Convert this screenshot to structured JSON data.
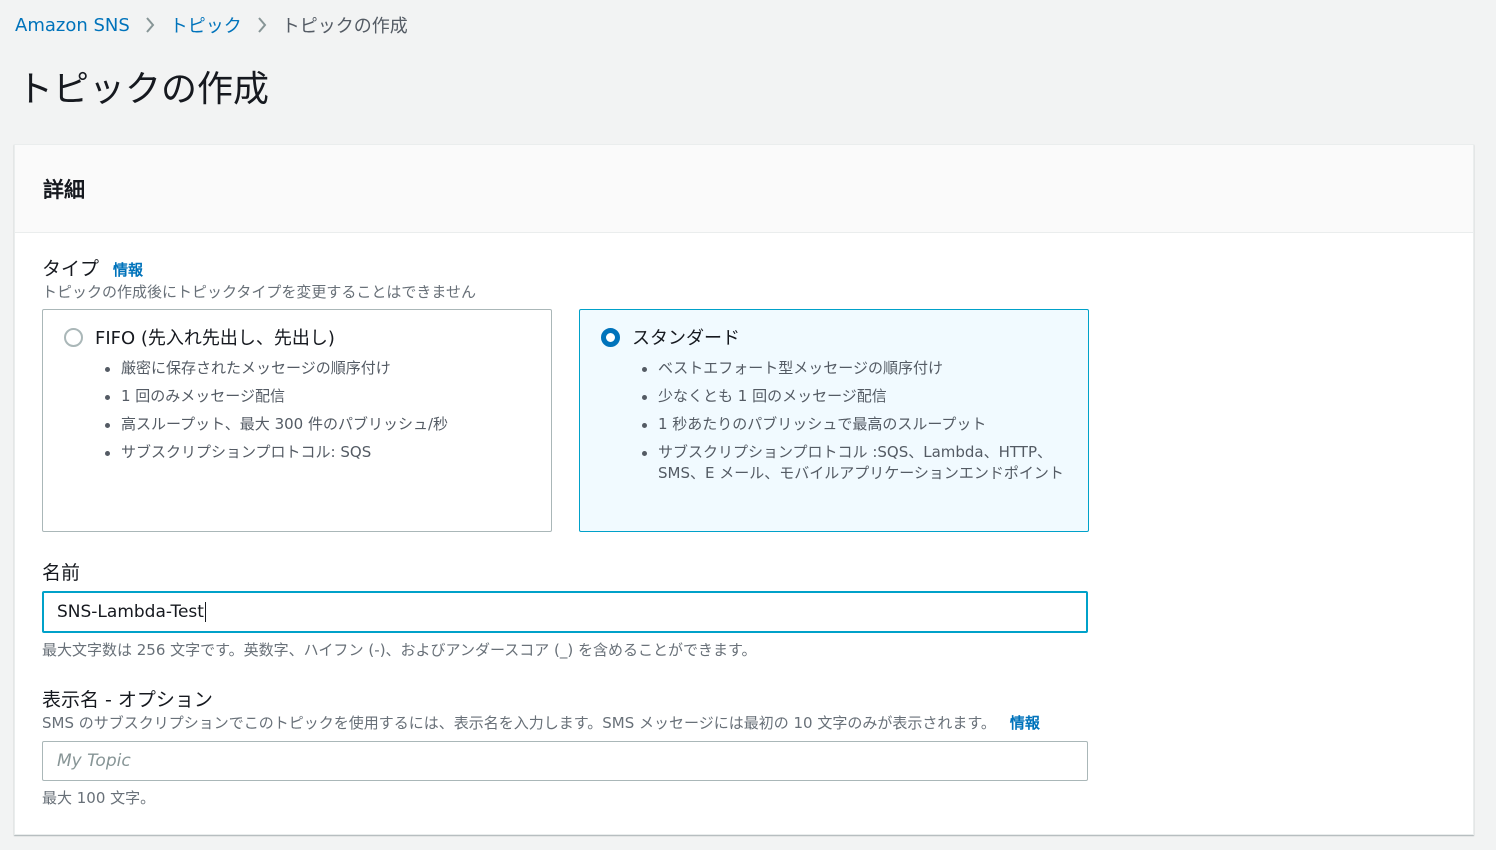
{
  "breadcrumb": {
    "items": [
      "Amazon SNS",
      "トピック"
    ],
    "current": "トピックの作成"
  },
  "page": {
    "title": "トピックの作成"
  },
  "details": {
    "title": "詳細",
    "type": {
      "label": "タイプ",
      "info": "情報",
      "description": "トピックの作成後にトピックタイプを変更することはできません",
      "options": [
        {
          "title": "FIFO (先入れ先出し、先出し)",
          "selected": false,
          "features": [
            "厳密に保存されたメッセージの順序付け",
            "1 回のみメッセージ配信",
            "高スループット、最大 300 件のパブリッシュ/秒",
            "サブスクリプションプロトコル: SQS"
          ]
        },
        {
          "title": "スタンダード",
          "selected": true,
          "features": [
            "ベストエフォート型メッセージの順序付け",
            "少なくとも 1 回のメッセージ配信",
            "1 秒あたりのパブリッシュで最高のスループット",
            "サブスクリプションプロトコル :SQS、Lambda、HTTP、SMS、E メール、モバイルアプリケーションエンドポイント"
          ]
        }
      ]
    },
    "name": {
      "label": "名前",
      "value": "SNS-Lambda-Test",
      "hint": "最大文字数は 256 文字です。英数字、ハイフン (-)、およびアンダースコア (_) を含めることができます。"
    },
    "display_name": {
      "label": "表示名 - オプション",
      "description": "SMS のサブスクリプションでこのトピックを使用するには、表示名を入力します。SMS メッセージには最初の 10 文字のみが表示されます。",
      "info": "情報",
      "placeholder": "My Topic",
      "hint": "最大 100 文字。"
    }
  },
  "colors": {
    "link": "#0073bb",
    "selected_border": "#00a1c9",
    "selected_bg": "#f1faff",
    "background": "#f2f3f3"
  },
  "icons": [
    "chevron-right-icon",
    "radio-button-icon"
  ]
}
